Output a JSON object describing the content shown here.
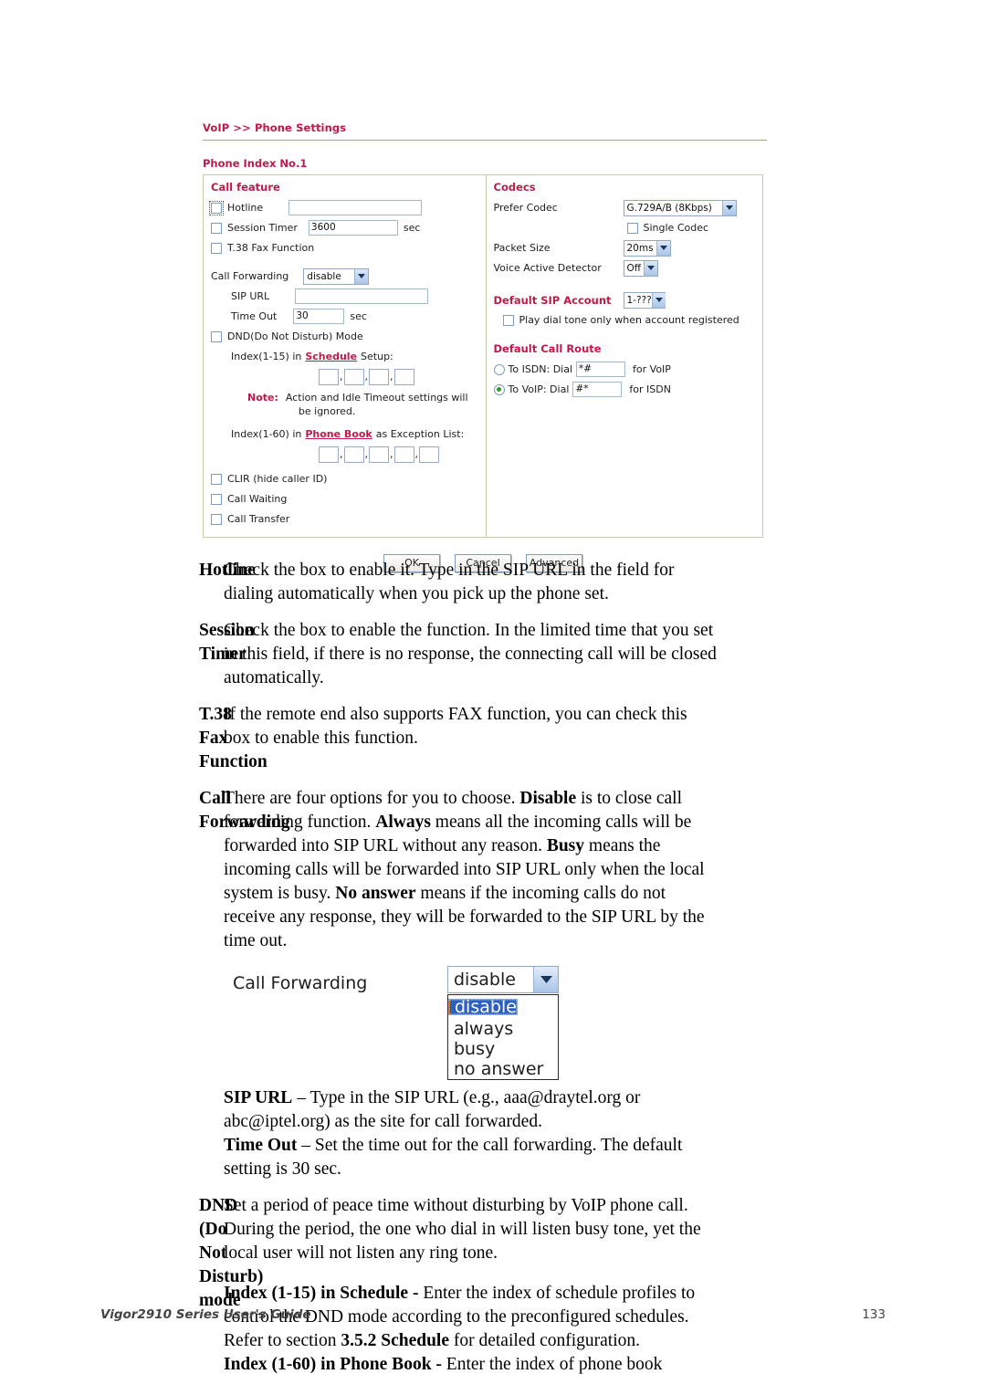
{
  "screenshot": {
    "breadcrumb": "VoIP >> Phone Settings",
    "phone_index_label": "Phone Index No.1",
    "left_panel": {
      "head": "Call feature",
      "hotline_label": "Hotline",
      "hotline_value": "",
      "session_timer_label": "Session Timer",
      "session_timer_value": "3600",
      "session_timer_unit": "sec",
      "t38_label": "T.38 Fax Function",
      "call_forwarding_label": "Call Forwarding",
      "call_forwarding_value": "disable",
      "sip_url_label": "SIP URL",
      "sip_url_value": "",
      "time_out_label": "Time Out",
      "time_out_value": "30",
      "time_out_unit": "sec",
      "dnd_label": "DND(Do Not Disturb) Mode",
      "schedule_prefix": "Index(1-15) in",
      "schedule_link": "Schedule",
      "schedule_suffix": "Setup:",
      "note_label": "Note:",
      "note_line1": "Action and Idle Timeout settings will",
      "note_line2": "be ignored.",
      "phonebook_prefix": "Index(1-60) in",
      "phonebook_link": "Phone Book",
      "phonebook_suffix": "as Exception List:",
      "clir_label": "CLIR (hide caller ID)",
      "call_waiting_label": "Call Waiting",
      "call_transfer_label": "Call Transfer"
    },
    "right_panel": {
      "codecs_head": "Codecs",
      "prefer_codec_label": "Prefer Codec",
      "prefer_codec_value": "G.729A/B (8Kbps)",
      "single_codec_label": "Single Codec",
      "packet_size_label": "Packet Size",
      "packet_size_value": "20ms",
      "vad_label": "Voice Active Detector",
      "vad_value": "Off",
      "default_sip_head": "Default SIP Account",
      "default_sip_value": "1-???",
      "play_dial_tone_label": "Play dial tone only when account registered",
      "default_call_route_head": "Default Call Route",
      "isdn_label": "To ISDN: Dial",
      "isdn_value": "*#",
      "isdn_suffix": "for VoIP",
      "voip_label": "To VoIP: Dial",
      "voip_value": "#*",
      "voip_suffix": "for ISDN"
    },
    "buttons": {
      "ok": "OK",
      "cancel": "Cancel",
      "advanced": "Advanced"
    }
  },
  "definitions": [
    {
      "term": "Hotline",
      "desc": "Check the box to enable it. Type in the SIP URL in the field for dialing automatically when you pick up the phone set."
    },
    {
      "term": "Session Timer",
      "desc": "Check the box to enable the function. In the limited time that you set in this field, if there is no response, the connecting call will be closed automatically."
    },
    {
      "term": "T.38 Fax Function",
      "desc": "If the remote end also supports FAX function, you can check this box to enable this function."
    }
  ],
  "call_forwarding": {
    "term": "Call Forwarding",
    "p1_a": "There are four options for you to choose. ",
    "p1_b": "Disable",
    "p1_c": " is to close call forwarding function. ",
    "p1_d": "Always",
    "p1_e": " means all the incoming calls will be forwarded into SIP URL without any reason. ",
    "p1_f": "Busy",
    "p1_g": " means the incoming calls will be forwarded into SIP URL only when the local system is busy. ",
    "p1_h": "No answer",
    "p1_i": " means if the incoming calls do not receive any response, they will be forwarded to the SIP URL by the time out.",
    "illus_label": "Call Forwarding",
    "illus_value": "disable",
    "illus_options": [
      "disable",
      "always",
      "busy",
      "no answer"
    ],
    "sip_url_bold": "SIP URL",
    "sip_url_rest": " – Type in the SIP URL (e.g., aaa@draytel.org or abc@iptel.org) as the site for call forwarded.",
    "time_out_bold": "Time Out",
    "time_out_rest": " – Set the time out for the call forwarding. The default setting is 30 sec."
  },
  "dnd": {
    "term_line1": "DND (Do Not Disturb)",
    "term_line2": "mode",
    "p1": "Set a period of peace time without disturbing by VoIP phone call. During the period, the one who dial in will listen busy tone, yet the local user will not listen any ring tone.",
    "p2_bold": "Index (1-15) in Schedule -",
    "p2_a": " Enter the index of schedule profiles to control the DND mode according to the preconfigured schedules. Refer to section ",
    "p2_bold2": "3.5.2 Schedule",
    "p2_b": " for detailed configuration.",
    "p3_bold": "Index (1-60) in Phone Book -",
    "p3_rest": " Enter the index of phone book"
  },
  "footer": {
    "left": "Vigor2910 Series User's Guide",
    "page": "133"
  },
  "colors": {
    "heading_red": "#bf1a4a",
    "rule_olive": "#a8a96a",
    "panel_border": "#c9c9a8",
    "select_blue": "#a9c4e6",
    "radio_on_green": "#2f9a2f",
    "dropdown_highlight": "#2c5fbe"
  }
}
